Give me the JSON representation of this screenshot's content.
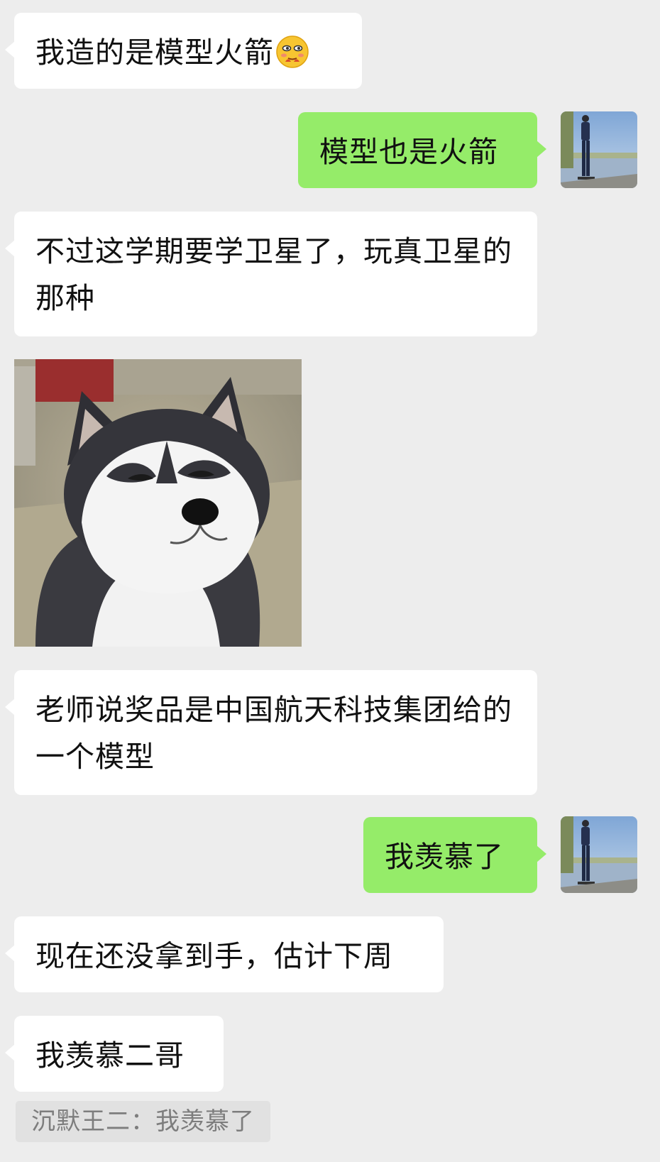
{
  "messages": [
    {
      "text": "我造的是模型火箭",
      "emoji": "shy-blush-emoji"
    },
    {
      "text": "模型也是火箭"
    },
    {
      "text": "不过这学期要学卫星了，玩真卫星的那种"
    },
    {
      "sticker": "husky-smug-face"
    },
    {
      "text": "老师说奖品是中国航天科技集团给的一个模型"
    },
    {
      "text": "我羡慕了"
    },
    {
      "text": "现在还没拿到手，估计下周"
    },
    {
      "text": "我羡慕二哥"
    }
  ],
  "quote": {
    "text": "沉默王二：我羡慕了"
  },
  "colors": {
    "background": "#ededed",
    "incoming_bubble": "#ffffff",
    "outgoing_bubble": "#95ec69",
    "quote_background": "#e1e1e1"
  }
}
